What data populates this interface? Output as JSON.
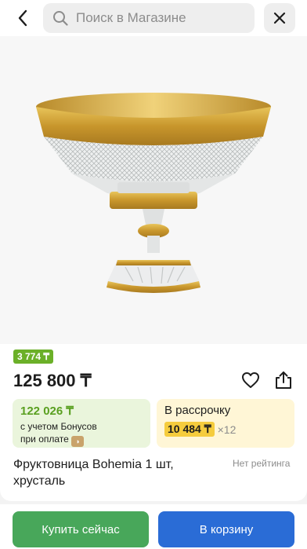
{
  "search": {
    "placeholder": "Поиск в Магазине"
  },
  "product": {
    "bonus_badge": "3 774 ₸",
    "price": "125 800 ₸",
    "bonus_price": "122 026 ₸",
    "bonus_line1": "с учетом Бонусов",
    "bonus_line2": "при оплате",
    "installment_title": "В рассрочку",
    "installment_amount": "10 484 ₸",
    "installment_multiplier": "×12",
    "title": "Фруктовница Bohemia 1 шт, хрусталь",
    "rating": "Нет рейтинга"
  },
  "actions": {
    "buy_now": "Купить сейчас",
    "add_to_cart": "В корзину"
  },
  "colors": {
    "green_accent": "#48a75a",
    "blue_accent": "#2a6cd6",
    "bonus_green": "#6bb028",
    "installment_yellow": "#f5cc3d"
  }
}
